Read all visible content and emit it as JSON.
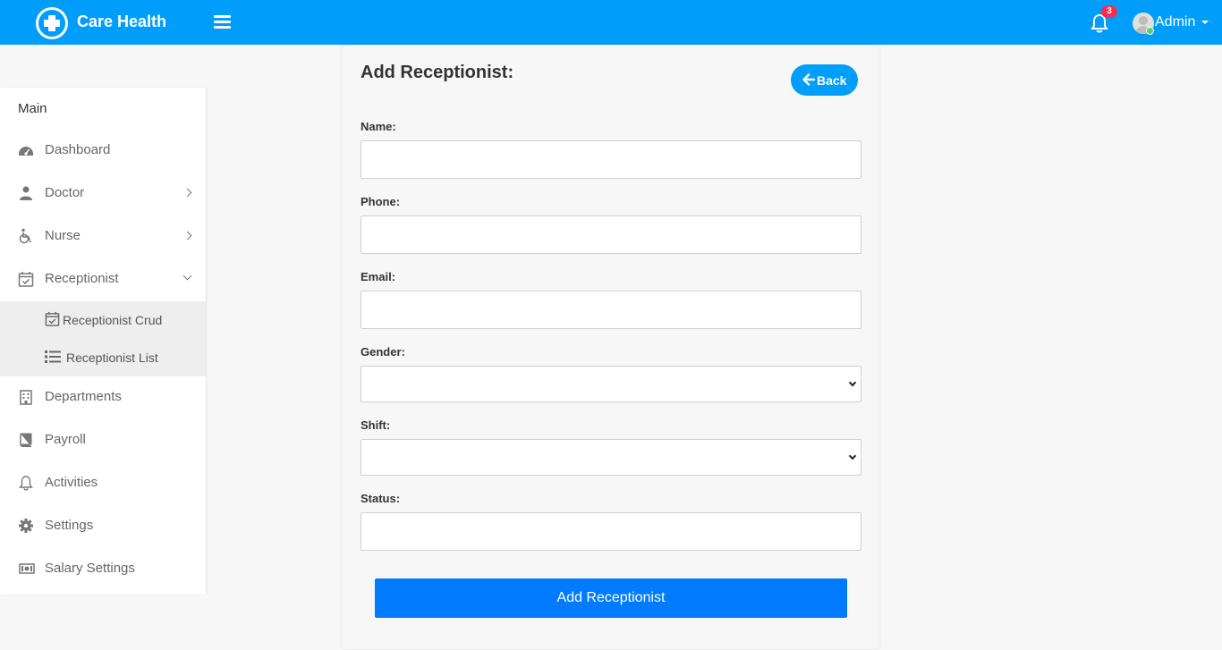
{
  "header": {
    "brand": "Care Health",
    "notification_count": "3",
    "user_name": "Admin"
  },
  "sidebar": {
    "menu_title": "Main",
    "items": [
      {
        "label": "Dashboard",
        "icon": "dashboard-icon"
      },
      {
        "label": "Doctor",
        "icon": "doctor-icon"
      },
      {
        "label": "Nurse",
        "icon": "wheelchair-icon"
      },
      {
        "label": "Receptionist",
        "icon": "calendar-check-icon"
      },
      {
        "label": "Departments",
        "icon": "hospital-icon"
      },
      {
        "label": "Payroll",
        "icon": "book-icon"
      },
      {
        "label": "Activities",
        "icon": "bell-icon"
      },
      {
        "label": "Settings",
        "icon": "gear-icon"
      },
      {
        "label": "Salary Settings",
        "icon": "money-bill-icon"
      }
    ],
    "submenu": [
      {
        "label": "Receptionist Crud",
        "icon": "calendar-check-icon"
      },
      {
        "label": "Receptionist List",
        "icon": "list-icon"
      }
    ]
  },
  "form": {
    "title": "Add Receptionist:",
    "back_label": "Back",
    "fields": {
      "name": {
        "label": "Name:",
        "value": ""
      },
      "phone": {
        "label": "Phone:",
        "value": ""
      },
      "email": {
        "label": "Email:",
        "value": ""
      },
      "gender": {
        "label": "Gender:",
        "value": ""
      },
      "shift": {
        "label": "Shift:",
        "value": ""
      },
      "status": {
        "label": "Status:",
        "value": ""
      }
    },
    "submit_label": "Add Receptionist"
  },
  "colors": {
    "primary": "#009efb",
    "submit": "#007bff",
    "badge": "#f62d51",
    "online": "#55ce63"
  }
}
